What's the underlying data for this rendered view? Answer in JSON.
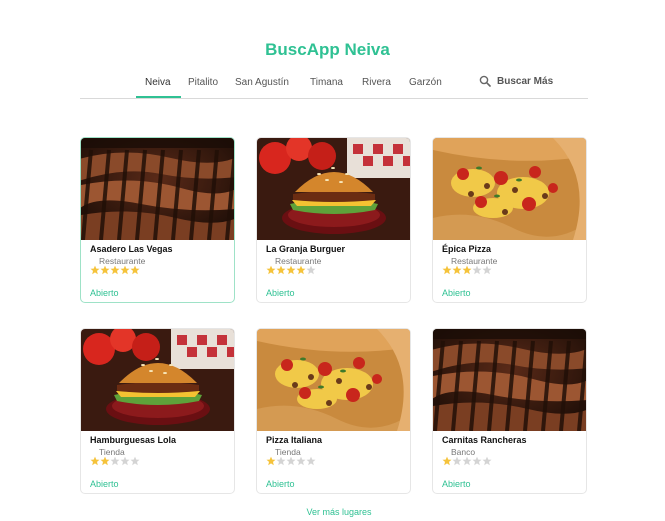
{
  "header": {
    "title": "BuscApp Neiva"
  },
  "nav": {
    "items": [
      "Neiva",
      "Pitalito",
      "San Agustín",
      "Timana",
      "Rivera",
      "Garzón"
    ],
    "active": "Neiva",
    "search_label": "Buscar Más"
  },
  "colors": {
    "accent": "#2fc193",
    "star_on": "#f5c33b",
    "star_off": "#d4d4d4"
  },
  "cards": [
    {
      "name": "Asadero Las Vegas",
      "category": "Restaurante",
      "rating": 5,
      "status": "Abierto",
      "image": "grilled-meat"
    },
    {
      "name": "La Granja Burguer",
      "category": "Restaurante",
      "rating": 4,
      "status": "Abierto",
      "image": "burger"
    },
    {
      "name": "Épica Pizza",
      "category": "Restaurante",
      "rating": 3,
      "status": "Abierto",
      "image": "pizza"
    },
    {
      "name": "Hamburguesas Lola",
      "category": "Tienda",
      "rating": 2,
      "status": "Abierto",
      "image": "burger"
    },
    {
      "name": "Pizza Italiana",
      "category": "Tienda",
      "rating": 1,
      "status": "Abierto",
      "image": "pizza"
    },
    {
      "name": "Carnitas Rancheras",
      "category": "Banco",
      "rating": 1,
      "status": "Abierto",
      "image": "grilled-meat"
    }
  ],
  "footer": {
    "more_label": "Ver más lugares"
  }
}
